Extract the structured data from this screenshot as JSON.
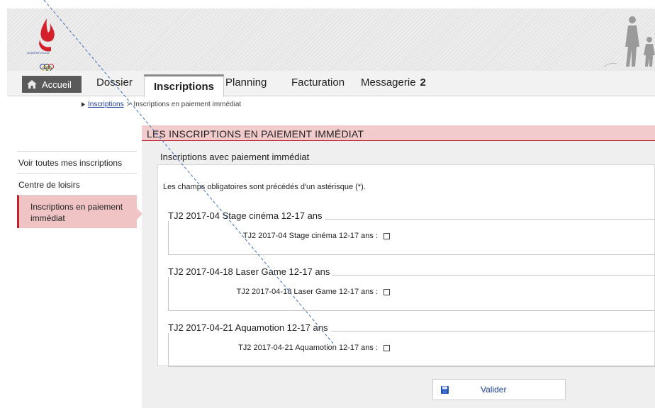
{
  "header": {
    "logo_text": "ALBERTVILLE",
    "colors": {
      "banner": "#e6e6e6",
      "accent": "#c0212b"
    }
  },
  "nav": {
    "home_label": "Accueil",
    "items": [
      {
        "label": "Dossier"
      },
      {
        "label": "Inscriptions"
      },
      {
        "label": "Planning"
      },
      {
        "label": "Facturation"
      },
      {
        "label": "Messagerie",
        "badge": "2"
      }
    ]
  },
  "breadcrumb": {
    "parent": "Inscriptions",
    "separator": ">",
    "current": "Inscriptions en paiement immédiat"
  },
  "sidebar": {
    "items": [
      {
        "label": "Voir toutes mes inscriptions"
      },
      {
        "label": "Centre de loisirs"
      },
      {
        "label": "Inscriptions en paiement immédiat",
        "active": true
      }
    ]
  },
  "main": {
    "page_title": "LES INSCRIPTIONS EN PAIEMENT IMMÉDIAT",
    "section_title": "Inscriptions avec paiement immédiat",
    "required_note": "Les champs obligatoires sont précédés d'un astérisque (*).",
    "activities": [
      {
        "title": "TJ2 2017-04 Stage cinéma 12-17 ans",
        "field_label": "TJ2 2017-04 Stage cinéma 12-17 ans :"
      },
      {
        "title": "TJ2 2017-04-18 Laser Game 12-17 ans",
        "field_label": "TJ2 2017-04-18 Laser Game 12-17 ans :"
      },
      {
        "title": "TJ2 2017-04-21 Aquamotion 12-17 ans",
        "field_label": "TJ2 2017-04-21 Aquamotion 12-17 ans :"
      }
    ],
    "validate_label": "Valider"
  }
}
